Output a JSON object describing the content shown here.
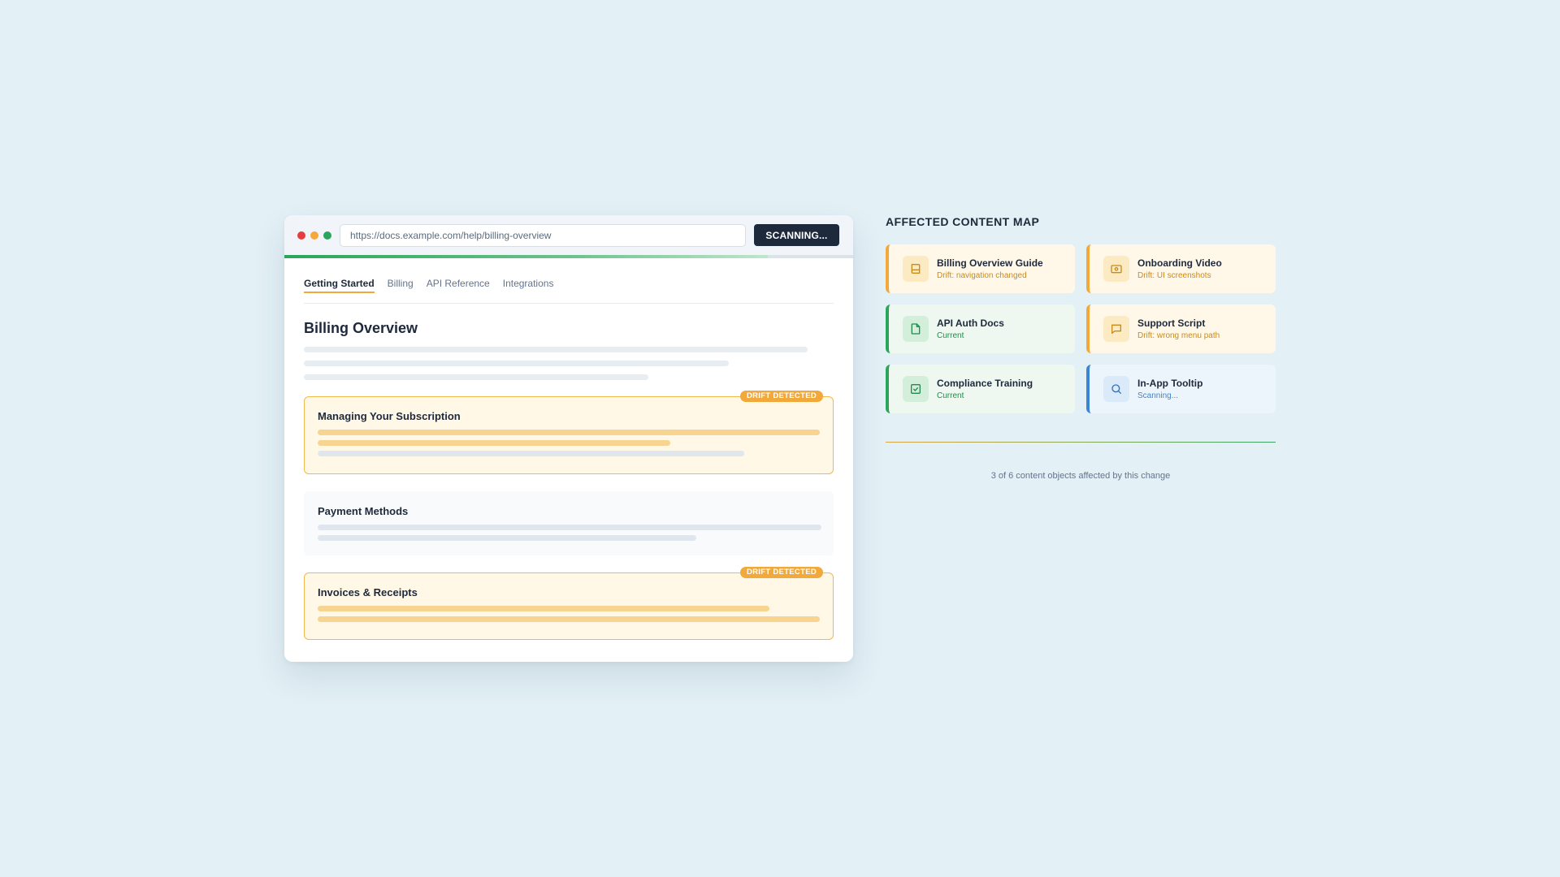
{
  "browser": {
    "url": "https://docs.example.com/help/billing-overview",
    "scan_button": "SCANNING...",
    "scan_progress": 0.85,
    "tabs": [
      {
        "label": "Getting Started",
        "active": true
      },
      {
        "label": "Billing",
        "active": false
      },
      {
        "label": "API Reference",
        "active": false
      },
      {
        "label": "Integrations",
        "active": false
      }
    ],
    "page_title": "Billing Overview",
    "sections": [
      {
        "title": "Managing Your Subscription",
        "state": "drift",
        "badge": "DRIFT DETECTED"
      },
      {
        "title": "Payment Methods",
        "state": "ok",
        "badge": ""
      },
      {
        "title": "Invoices & Receipts",
        "state": "drift",
        "badge": "DRIFT DETECTED"
      }
    ]
  },
  "panel": {
    "title": "AFFECTED CONTENT MAP",
    "cards": [
      {
        "title": "Billing Overview Guide",
        "status": "Drift: navigation changed",
        "state": "warn",
        "icon": "book-icon"
      },
      {
        "title": "Onboarding Video",
        "status": "Drift: UI screenshots",
        "state": "warn",
        "icon": "video-icon"
      },
      {
        "title": "API Auth Docs",
        "status": "Current",
        "state": "ok",
        "icon": "document-icon"
      },
      {
        "title": "Support Script",
        "status": "Drift: wrong menu path",
        "state": "warn",
        "icon": "chat-icon"
      },
      {
        "title": "Compliance Training",
        "status": "Current",
        "state": "ok",
        "icon": "checkbox-icon"
      },
      {
        "title": "In-App Tooltip",
        "status": "Scanning...",
        "state": "scan",
        "icon": "search-icon"
      }
    ],
    "summary": "3 of 6 content objects affected by this change"
  },
  "colors": {
    "background": "#e3f0f6",
    "accent_amber": "#f2a93b",
    "accent_green": "#2aa55b",
    "accent_blue": "#3c85d2",
    "dark": "#1e2a3b"
  }
}
